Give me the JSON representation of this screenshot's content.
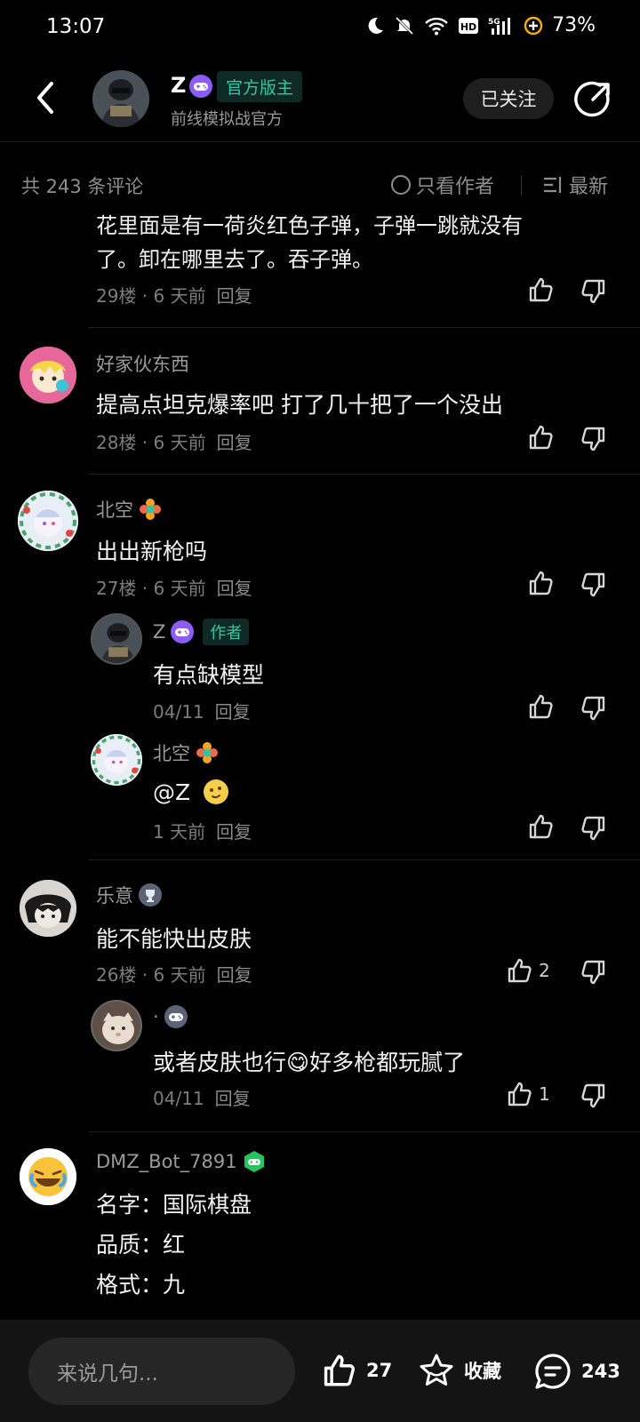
{
  "status_bar": {
    "time": "13:07",
    "battery": "73%"
  },
  "header": {
    "name": "Z",
    "official_tag": "官方版主",
    "subtitle": "前线模拟战官方",
    "follow_label": "已关注"
  },
  "toolbar": {
    "comment_count": "共 243 条评论",
    "only_author": "只看作者",
    "sort": "最新"
  },
  "comments": {
    "c29": {
      "text_cut": "花里面是有一荷炎红色子弹，子弹一跳就没有",
      "text": "了。卸在哪里去了。吞子弹。",
      "floor": "29楼 · 6 天前",
      "reply": "回复"
    },
    "c28": {
      "name": "好家伙东西",
      "text": "提高点坦克爆率吧 打了几十把了一个没出",
      "floor": "28楼 · 6 天前",
      "reply": "回复"
    },
    "c27": {
      "name": "北空",
      "text": "出出新枪吗",
      "floor": "27楼 · 6 天前",
      "reply": "回复",
      "replies": [
        {
          "name": "Z",
          "tag": "作者",
          "text": "有点缺模型",
          "date": "04/11",
          "reply": "回复"
        },
        {
          "name": "北空",
          "text": "@Z",
          "date": "1 天前",
          "reply": "回复"
        }
      ]
    },
    "c26": {
      "name": "乐意",
      "text": "能不能快出皮肤",
      "floor": "26楼 · 6 天前",
      "reply": "回复",
      "likes": "2",
      "replies": [
        {
          "name": "·",
          "text": "或者皮肤也行😋好多枪都玩腻了",
          "date": "04/11",
          "reply": "回复",
          "likes": "1"
        }
      ]
    },
    "c25": {
      "name": "DMZ_Bot_7891",
      "line1": "名字：国际棋盘",
      "line2": "品质：红",
      "line3": "格式：九"
    }
  },
  "bottom_bar": {
    "input_placeholder": "来说几句...",
    "likes": "27",
    "favorite_label": "收藏",
    "comments": "243"
  },
  "colors": {
    "accent_teal": "#30c9a6",
    "badge_purple": "#8b5cf6",
    "badge_green": "#22c55e"
  }
}
